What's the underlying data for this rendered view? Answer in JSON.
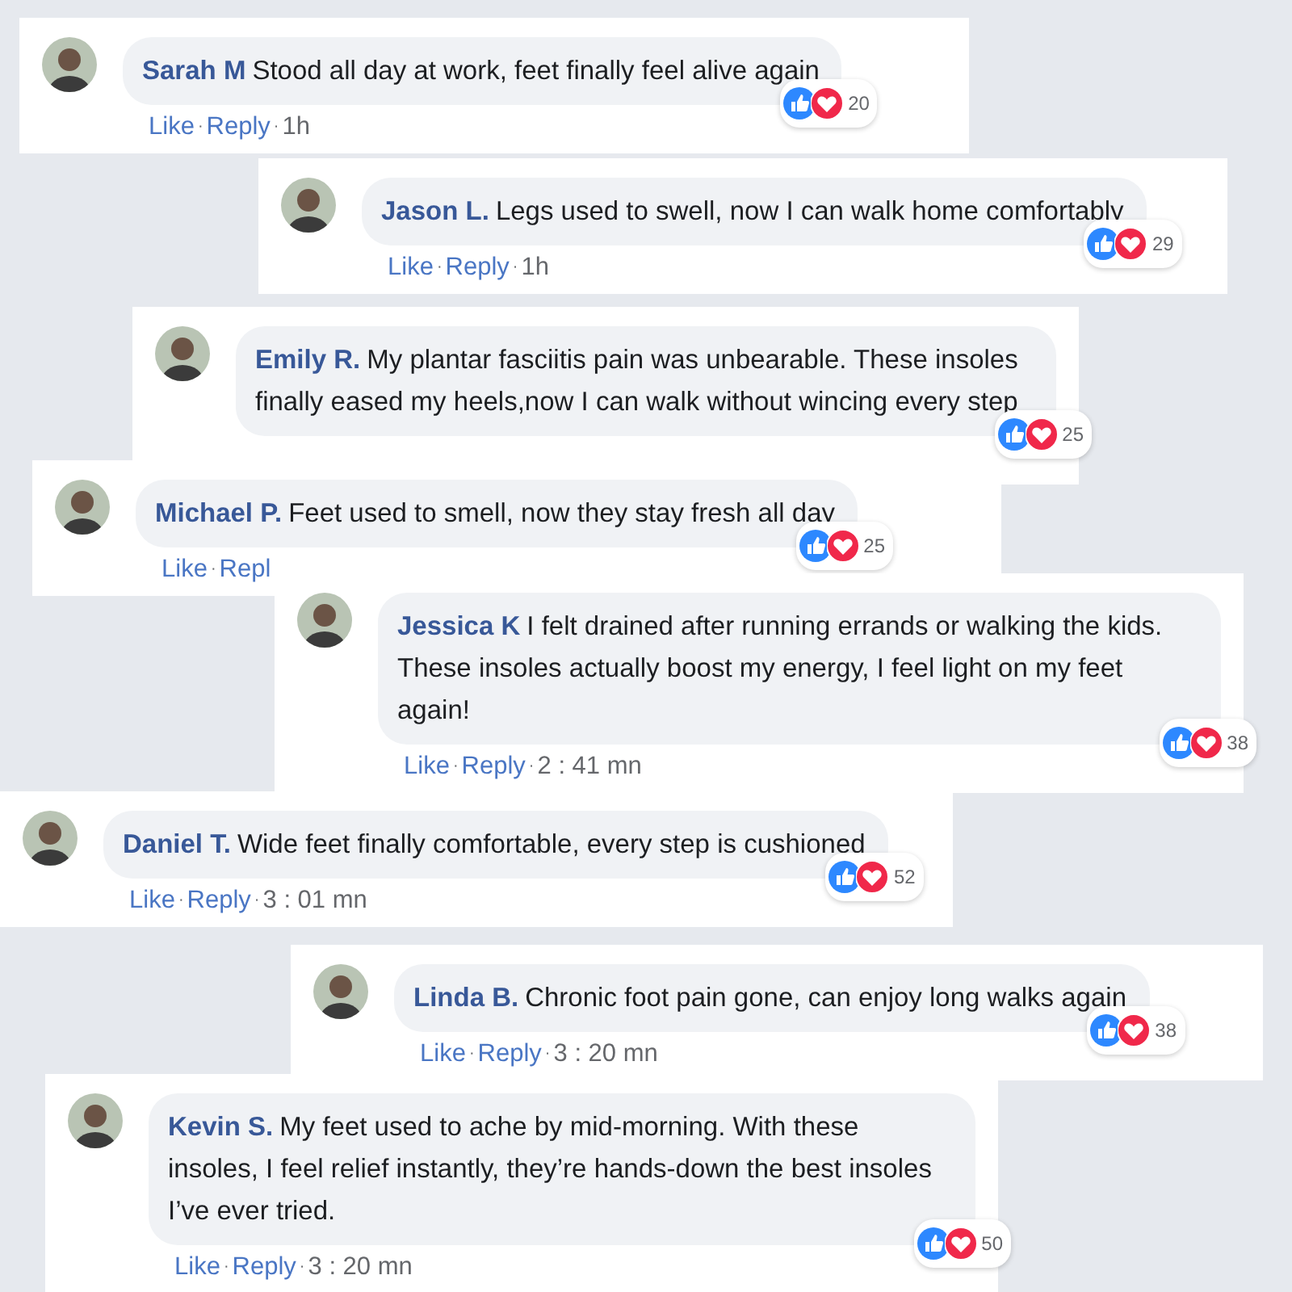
{
  "comments": [
    {
      "name": "Sarah M",
      "text": "Stood all day at work, feet finally feel alive again",
      "reactions": "20",
      "actions": [
        {
          "kind": "link",
          "text": "Like"
        },
        {
          "kind": "dot",
          "text": "·"
        },
        {
          "kind": "link",
          "text": "Reply"
        },
        {
          "kind": "dot",
          "text": "·"
        },
        {
          "kind": "time",
          "text": "1h"
        }
      ]
    },
    {
      "name": "Jason L.",
      "text": "Legs used to swell, now I can walk home comfortably",
      "reactions": "29",
      "actions": [
        {
          "kind": "link",
          "text": "Like"
        },
        {
          "kind": "dot",
          "text": "·"
        },
        {
          "kind": "link",
          "text": "Reply"
        },
        {
          "kind": "dot",
          "text": "·"
        },
        {
          "kind": "time",
          "text": "1h"
        }
      ]
    },
    {
      "name": "Emily R.",
      "text": "My plantar fasciitis pain was unbearable. These insoles finally eased my heels,now I can walk without wincing every step",
      "reactions": "25"
    },
    {
      "name": "Michael P.",
      "text": "Feet used to smell, now they stay fresh all day",
      "reactions": "25",
      "actions": [
        {
          "kind": "link",
          "text": "Like"
        },
        {
          "kind": "dot",
          "text": "·"
        },
        {
          "kind": "link",
          "text": "Repl"
        }
      ]
    },
    {
      "name": "Jessica K",
      "text": "I felt drained after running errands or walking the kids. These insoles actually boost my energy, I feel light on my feet again!",
      "reactions": "38",
      "actions": [
        {
          "kind": "link",
          "text": "Like"
        },
        {
          "kind": "dot",
          "text": "·"
        },
        {
          "kind": "link",
          "text": "Reply"
        },
        {
          "kind": "dot",
          "text": "·"
        },
        {
          "kind": "time",
          "text": "2 : 41 mn"
        }
      ]
    },
    {
      "name": "Daniel T.",
      "text": "Wide feet finally comfortable, every step is cushioned",
      "reactions": "52",
      "actions": [
        {
          "kind": "link",
          "text": "Like"
        },
        {
          "kind": "dot",
          "text": "·"
        },
        {
          "kind": "link",
          "text": "Reply"
        },
        {
          "kind": "dot",
          "text": "·"
        },
        {
          "kind": "time",
          "text": "3 : 01 mn"
        }
      ]
    },
    {
      "name": "Linda B.",
      "text": "Chronic foot pain gone, can enjoy long walks again",
      "reactions": "38",
      "actions": [
        {
          "kind": "link",
          "text": "Like"
        },
        {
          "kind": "dot",
          "text": "·"
        },
        {
          "kind": "link",
          "text": "Reply"
        },
        {
          "kind": "dot",
          "text": "·"
        },
        {
          "kind": "time",
          "text": "3 : 20 mn"
        }
      ]
    },
    {
      "name": "Kevin S.",
      "text": "My feet used to ache by mid-morning. With these insoles, I feel relief instantly, they’re hands-down the best insoles I’ve ever tried.",
      "reactions": "50",
      "actions": [
        {
          "kind": "link",
          "text": "Like"
        },
        {
          "kind": "dot",
          "text": "·"
        },
        {
          "kind": "link",
          "text": "Reply"
        },
        {
          "kind": "dot",
          "text": "·"
        },
        {
          "kind": "time",
          "text": "3 : 20 mn"
        }
      ]
    }
  ]
}
